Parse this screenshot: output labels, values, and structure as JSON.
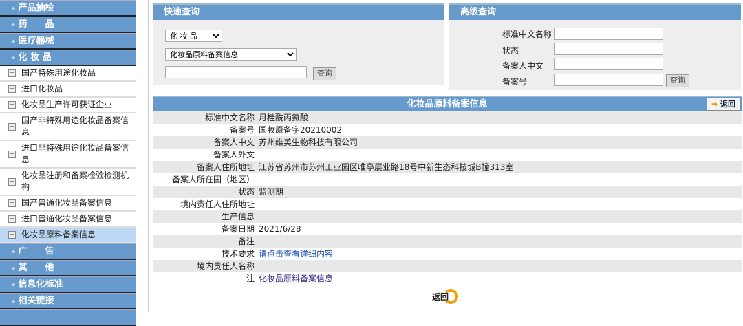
{
  "sidebar": {
    "headers_top": [
      "产品抽检",
      "药　　品",
      "医疗器械",
      "化 妆 品"
    ],
    "items": [
      "国产特殊用途化妆品",
      "进口化妆品",
      "化妆品生产许可获证企业",
      "国产非特殊用途化妆品备案信息",
      "进口非特殊用途化妆品备案信息",
      "化妆品注册和备案检验检测机构",
      "国产普通化妆品备案信息",
      "进口普通化妆品备案信息",
      "化妆品原料备案信息"
    ],
    "headers_bottom": [
      "广　　告",
      "其　　他",
      "信息化标准",
      "相关链接"
    ]
  },
  "quick": {
    "title": "快速查询",
    "category": "化 妆 品",
    "subcategory": "化妆品原料备案信息",
    "keyword": "",
    "search": "查询"
  },
  "advanced": {
    "title": "高级查询",
    "fields": [
      "标准中文名称",
      "状态",
      "备案人中文",
      "备案号"
    ],
    "search": "查询"
  },
  "detail": {
    "title": "化妆品原料备案信息",
    "back": "返回",
    "rows": [
      {
        "label": "标准中文名称",
        "value": "月桂酰丙氨酸"
      },
      {
        "label": "备案号",
        "value": "国妆原备字20210002"
      },
      {
        "label": "备案人中文",
        "value": "苏州维美生物科技有限公司"
      },
      {
        "label": "备案人外文",
        "value": ""
      },
      {
        "label": "备案人住所地址",
        "value": "江苏省苏州市苏州工业园区唯亭展业路18号中新生态科技城B幢313室"
      },
      {
        "label": "备案人所在国（地区）",
        "value": ""
      },
      {
        "label": "状态",
        "value": "监测期"
      },
      {
        "label": "境内责任人住所地址",
        "value": ""
      },
      {
        "label": "生产信息",
        "value": ""
      },
      {
        "label": "备案日期",
        "value": "2021/6/28"
      },
      {
        "label": "备注",
        "value": ""
      },
      {
        "label": "技术要求",
        "value": "请点击查看详细内容",
        "link": true
      },
      {
        "label": "境内责任人名称",
        "value": ""
      },
      {
        "label": "注",
        "value": "化妆品原料备案信息",
        "link": true
      }
    ]
  },
  "bottom_back": "返回"
}
